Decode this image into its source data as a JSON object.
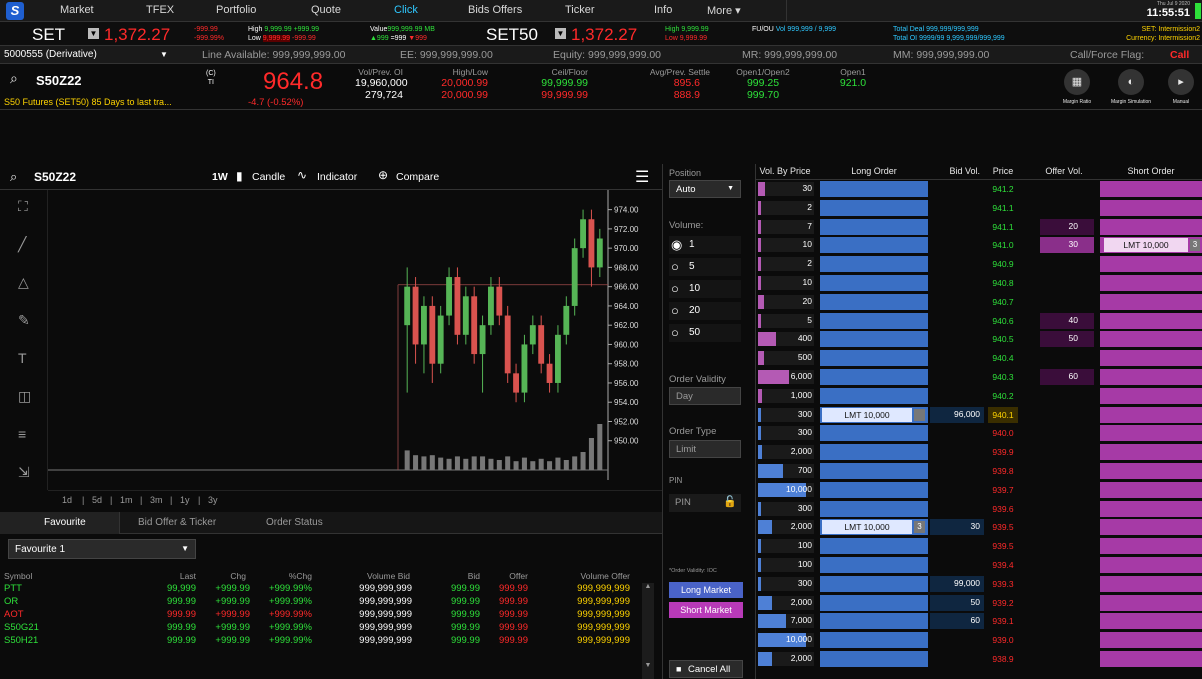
{
  "nav": {
    "logo": "S",
    "items": [
      "Market",
      "TFEX",
      "Portfolio",
      "Quote",
      "Click",
      "Bids Offers",
      "Ticker",
      "Info",
      "More ▾"
    ],
    "active_index": 4,
    "date": "Thu Jul 9 2020",
    "time": "11:55:51"
  },
  "index_strip": {
    "set_label": "SET",
    "set_value": "1,372.27",
    "set_chg": "-999.99",
    "set_pct": "-999.99%",
    "high_label": "High",
    "high_val": "9,999.99",
    "high_chg": "+999.99",
    "low_label": "Low",
    "low_val": "9,999.99",
    "low_chg": "-999.99",
    "value_label": "Value",
    "value_val": "999,999.99 MB",
    "adv": "▲999",
    "unch": "=999",
    "dec": "▼999",
    "set50_label": "SET50",
    "set50_value": "1,372.27",
    "set50_high": "High 9,999.99",
    "set50_low": "Low 9,999.99",
    "ffu_label": "FU/OU",
    "vol_text": "Vol 999,999 / 9,999",
    "total_deal": "Total Deal 999,999/999,999",
    "total_oi": "Total OI 9999/99  9,999,999/999,999",
    "set_status": "SET: Intermission2",
    "currency_status": "Currency: Intermission2"
  },
  "account": {
    "name": "5000555 (Derivative)",
    "line_available": "Line Available: 999,999,999.00",
    "ee": "EE: 999,999,999.00",
    "equity": "Equity: 999,999,999.00",
    "mr": "MR: 999,999,999.00",
    "mm": "MM: 999,999,999.00",
    "flag_label": "Call/Force Flag:",
    "flag_value": "Call"
  },
  "quote": {
    "symbol": "S50Z22",
    "badge_top": "(C)",
    "badge_bottom": "TI",
    "last": "964.8",
    "change": "-4.7 (-0.52%)",
    "description": "S50 Futures (SET50) 85 Days to last tra...",
    "cols": [
      {
        "label": "Vol/Prev. OI",
        "v1": "19,960,000",
        "v2": "279,724",
        "c1": "w",
        "c2": "w"
      },
      {
        "label": "High/Low",
        "v1": "20,000.99",
        "v2": "20,000.99",
        "c1": "r",
        "c2": "r"
      },
      {
        "label": "Ceil/Floor",
        "v1": "99,999.99",
        "v2": "99,999.99",
        "c1": "g",
        "c2": "r"
      },
      {
        "label": "Avg/Prev. Settle",
        "v1": "895.6",
        "v2": "888.9",
        "c1": "r",
        "c2": "r"
      },
      {
        "label": "Open1/Open2",
        "v1": "999.25",
        "v2": "999.70",
        "c1": "g",
        "c2": "g"
      },
      {
        "label": "Open1",
        "v1": "921.0",
        "v2": "",
        "c1": "g",
        "c2": "g"
      }
    ],
    "tools": [
      {
        "label": "Margin Ratio",
        "icon": "margin-ratio-icon"
      },
      {
        "label": "Margin Simulation",
        "icon": "margin-simulation-icon"
      },
      {
        "label": "Manual",
        "icon": "manual-icon"
      }
    ]
  },
  "chart_toolbar": {
    "symbol": "S50Z22",
    "period": "1W",
    "candle": "Candle",
    "indicator": "Indicator",
    "compare": "Compare"
  },
  "chart_data": {
    "type": "candlestick",
    "ylim": [
      948,
      975
    ],
    "y_ticks": [
      "974.00",
      "972.00",
      "970.00",
      "968.00",
      "966.00",
      "964.00",
      "962.00",
      "960.00",
      "958.00",
      "956.00",
      "954.00",
      "952.00",
      "950.00"
    ],
    "candles": [
      [
        962,
        966,
        955,
        968
      ],
      [
        966,
        960,
        958,
        967
      ],
      [
        960,
        964,
        957,
        965
      ],
      [
        964,
        958,
        956,
        965
      ],
      [
        958,
        963,
        957,
        964
      ],
      [
        963,
        967,
        962,
        968
      ],
      [
        967,
        961,
        960,
        968
      ],
      [
        961,
        965,
        960,
        966
      ],
      [
        965,
        959,
        958,
        966
      ],
      [
        959,
        962,
        955,
        963
      ],
      [
        962,
        966,
        961,
        967
      ],
      [
        966,
        963,
        962,
        967
      ],
      [
        963,
        957,
        956,
        964
      ],
      [
        957,
        955,
        954,
        958
      ],
      [
        955,
        960,
        954,
        961
      ],
      [
        960,
        962,
        959,
        963
      ],
      [
        962,
        958,
        957,
        963
      ],
      [
        958,
        956,
        955,
        959
      ],
      [
        956,
        961,
        955,
        962
      ],
      [
        961,
        964,
        960,
        965
      ],
      [
        964,
        970,
        963,
        971
      ],
      [
        970,
        973,
        969,
        974
      ],
      [
        973,
        968,
        966,
        974
      ],
      [
        968,
        971,
        967,
        972
      ]
    ],
    "ref_line": 966.2,
    "range_buttons": [
      "1d",
      "5d",
      "1m",
      "3m",
      "1y",
      "3y"
    ]
  },
  "bottom_tabs": [
    "Favourite",
    "Bid Offer & Ticker",
    "Order Status"
  ],
  "favourite": {
    "selected": "Favourite 1",
    "headers": [
      "Symbol",
      "Last",
      "Chg",
      "%Chg",
      "Volume Bid",
      "Bid",
      "Offer",
      "Volume Offer"
    ],
    "rows": [
      {
        "sym": "PTT",
        "color": "g",
        "last": "99,999",
        "chg": "+999.99",
        "pct": "+999.99%",
        "vb": "999,999,999",
        "bid": "999.99",
        "off": "999.99",
        "vo": "999,999,999"
      },
      {
        "sym": "OR",
        "color": "g",
        "last": "999.99",
        "chg": "+999.99",
        "pct": "+999.99%",
        "vb": "999,999,999",
        "bid": "999.99",
        "off": "999.99",
        "vo": "999,999,999"
      },
      {
        "sym": "AOT",
        "color": "r",
        "last": "999.99",
        "chg": "+999.99",
        "pct": "+999.99%",
        "vb": "999,999,999",
        "bid": "999.99",
        "off": "999.99",
        "vo": "999,999,999"
      },
      {
        "sym": "S50G21",
        "color": "g",
        "last": "999.99",
        "chg": "+999.99",
        "pct": "+999.99%",
        "vb": "999,999,999",
        "bid": "999.99",
        "off": "999.99",
        "vo": "999,999,999"
      },
      {
        "sym": "S50H21",
        "color": "g",
        "last": "999.99",
        "chg": "+999.99",
        "pct": "+999.99%",
        "vb": "999,999,999",
        "bid": "999.99",
        "off": "999.99",
        "vo": "999,999,999"
      }
    ]
  },
  "order_panel": {
    "position_label": "Position",
    "position_value": "Auto",
    "volume_label": "Volume:",
    "volume_options": [
      "1",
      "5",
      "10",
      "20",
      "50"
    ],
    "validity_label": "Order Validity",
    "validity_value": "Day",
    "type_label": "Order Type",
    "type_value": "Limit",
    "pin_label": "PIN",
    "pin_placeholder": "PIN",
    "note": "*Order Validity: IOC",
    "long_market": "Long Market",
    "short_market": "Short Market",
    "cancel_all": "Cancel All"
  },
  "book": {
    "headers": [
      "Vol. By Price",
      "Long Order",
      "Bid Vol.",
      "Price",
      "Offer Vol.",
      "Short Order"
    ],
    "rows": [
      {
        "vbp": "30",
        "fill": 0.12,
        "lo": "",
        "bid": "",
        "price": "941.2",
        "pc": "g",
        "off": "",
        "so": ""
      },
      {
        "vbp": "2",
        "fill": 0.02,
        "lo": "",
        "bid": "",
        "price": "941.1",
        "pc": "g",
        "off": "",
        "so": ""
      },
      {
        "vbp": "7",
        "fill": 0.05,
        "lo": "",
        "bid": "",
        "price": "941.1",
        "pc": "g",
        "off": "20",
        "so": ""
      },
      {
        "vbp": "10",
        "fill": 0.06,
        "lo": "",
        "bid": "",
        "price": "941.0",
        "pc": "g",
        "off": "30",
        "so": "LMT 10,000",
        "sobadge": "3"
      },
      {
        "vbp": "2",
        "fill": 0.02,
        "lo": "",
        "bid": "",
        "price": "940.9",
        "pc": "g",
        "off": "",
        "so": ""
      },
      {
        "vbp": "10",
        "fill": 0.06,
        "lo": "",
        "bid": "",
        "price": "940.8",
        "pc": "g",
        "off": "",
        "so": ""
      },
      {
        "vbp": "20",
        "fill": 0.1,
        "lo": "",
        "bid": "",
        "price": "940.7",
        "pc": "g",
        "off": "",
        "so": ""
      },
      {
        "vbp": "5",
        "fill": 0.04,
        "lo": "",
        "bid": "",
        "price": "940.6",
        "pc": "g",
        "off": "40",
        "so": ""
      },
      {
        "vbp": "400",
        "fill": 0.32,
        "lo": "",
        "bid": "",
        "price": "940.5",
        "pc": "g",
        "off": "50",
        "so": ""
      },
      {
        "vbp": "500",
        "fill": 0.1,
        "lo": "",
        "bid": "",
        "price": "940.4",
        "pc": "g",
        "off": "",
        "so": ""
      },
      {
        "vbp": "6,000",
        "fill": 0.55,
        "lo": "",
        "bid": "",
        "price": "940.3",
        "pc": "g",
        "off": "60",
        "so": ""
      },
      {
        "vbp": "1,000",
        "fill": 0.08,
        "lo": "",
        "bid": "",
        "price": "940.2",
        "pc": "g",
        "off": "",
        "so": ""
      },
      {
        "vbp": "300",
        "fill": 0.05,
        "lo": "LMT 10,000",
        "lobadge": "",
        "bid": "96,000",
        "price": "940.1",
        "pc": "y",
        "off": "",
        "so": ""
      },
      {
        "vbp": "300",
        "fill": 0.05,
        "lo": "",
        "bid": "",
        "price": "940.0",
        "pc": "r",
        "off": "",
        "so": ""
      },
      {
        "vbp": "2,000",
        "fill": 0.08,
        "lo": "",
        "bid": "",
        "price": "939.9",
        "pc": "r",
        "off": "",
        "so": ""
      },
      {
        "vbp": "700",
        "fill": 0.45,
        "lo": "",
        "bid": "",
        "price": "939.8",
        "pc": "r",
        "off": "",
        "so": ""
      },
      {
        "vbp": "10,000",
        "fill": 0.85,
        "lo": "",
        "bid": "",
        "price": "939.7",
        "pc": "r",
        "off": "",
        "so": ""
      },
      {
        "vbp": "300",
        "fill": 0.05,
        "lo": "",
        "bid": "",
        "price": "939.6",
        "pc": "r",
        "off": "",
        "so": ""
      },
      {
        "vbp": "2,000",
        "fill": 0.25,
        "lo": "LMT 10,000",
        "lobadge": "3",
        "bid": "30",
        "price": "939.5",
        "pc": "r",
        "off": "",
        "so": ""
      },
      {
        "vbp": "100",
        "fill": 0.04,
        "lo": "",
        "bid": "",
        "price": "939.5",
        "pc": "r",
        "off": "",
        "so": ""
      },
      {
        "vbp": "100",
        "fill": 0.04,
        "lo": "",
        "bid": "",
        "price": "939.4",
        "pc": "r",
        "off": "",
        "so": ""
      },
      {
        "vbp": "300",
        "fill": 0.05,
        "lo": "",
        "bid": "99,000",
        "price": "939.3",
        "pc": "r",
        "off": "",
        "so": ""
      },
      {
        "vbp": "2,000",
        "fill": 0.25,
        "lo": "",
        "bid": "50",
        "price": "939.2",
        "pc": "r",
        "off": "",
        "so": ""
      },
      {
        "vbp": "7,000",
        "fill": 0.5,
        "lo": "",
        "bid": "60",
        "price": "939.1",
        "pc": "r",
        "off": "",
        "so": ""
      },
      {
        "vbp": "10,000",
        "fill": 0.85,
        "lo": "",
        "bid": "",
        "price": "939.0",
        "pc": "r",
        "off": "",
        "so": ""
      },
      {
        "vbp": "2,000",
        "fill": 0.25,
        "lo": "",
        "bid": "",
        "price": "938.9",
        "pc": "r",
        "off": "",
        "so": ""
      }
    ]
  }
}
